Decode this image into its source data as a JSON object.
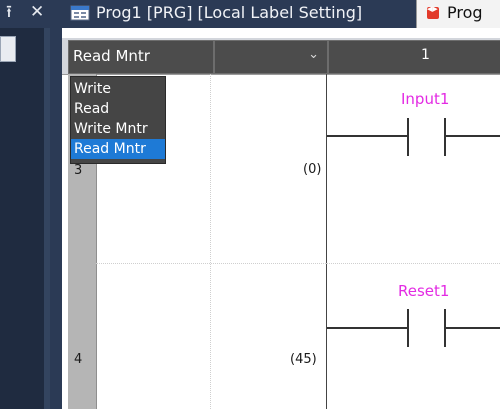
{
  "tabs": {
    "pin_glyph": "⭱",
    "close_glyph": "✕",
    "prog1_title": "Prog1 [PRG] [Local Label Setting]",
    "prog2_title": "Prog"
  },
  "header": {
    "mode_selected": "Read Mntr",
    "column_number": "1"
  },
  "dropdown": {
    "options": [
      "Write",
      "Read",
      "Write Mntr",
      "Read Mntr"
    ],
    "selected_index": 3
  },
  "rows": [
    {
      "row_number": "3",
      "step": "(0)",
      "contact_label": "Input1"
    },
    {
      "row_number": "4",
      "step": "(45)",
      "contact_label": "Reset1"
    }
  ],
  "colors": {
    "accent_selection": "#1e7ad6",
    "label_magenta": "#e32be3"
  }
}
